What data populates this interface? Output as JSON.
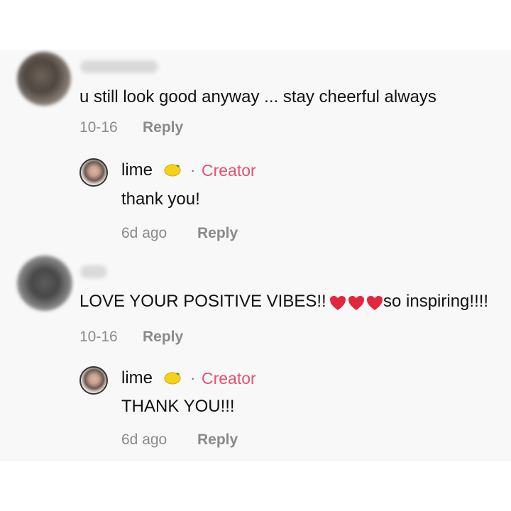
{
  "comments": [
    {
      "text": "u still look good anyway ... stay cheerful always",
      "date": "10-16",
      "reply_label": "Reply",
      "reply": {
        "name": "lime",
        "separator": "·",
        "creator_label": "Creator",
        "text": "thank you!",
        "time": "6d ago",
        "reply_label": "Reply",
        "icon": "lemon-icon"
      }
    },
    {
      "text_prefix": "LOVE YOUR POSITIVE VIBES!!",
      "text_suffix": "so inspiring!!!!",
      "date": "10-16",
      "reply_label": "Reply",
      "heart_icons": [
        "heart-icon",
        "heart-icon",
        "heart-icon"
      ],
      "reply": {
        "name": "lime",
        "separator": "·",
        "creator_label": "Creator",
        "text": "THANK YOU!!!",
        "time": "6d ago",
        "reply_label": "Reply",
        "icon": "lemon-icon"
      }
    }
  ],
  "colors": {
    "background": "#f8f8f8",
    "text": "#111111",
    "meta": "#8a8a8a",
    "creator": "#e45071",
    "heart": "#e2263d"
  }
}
